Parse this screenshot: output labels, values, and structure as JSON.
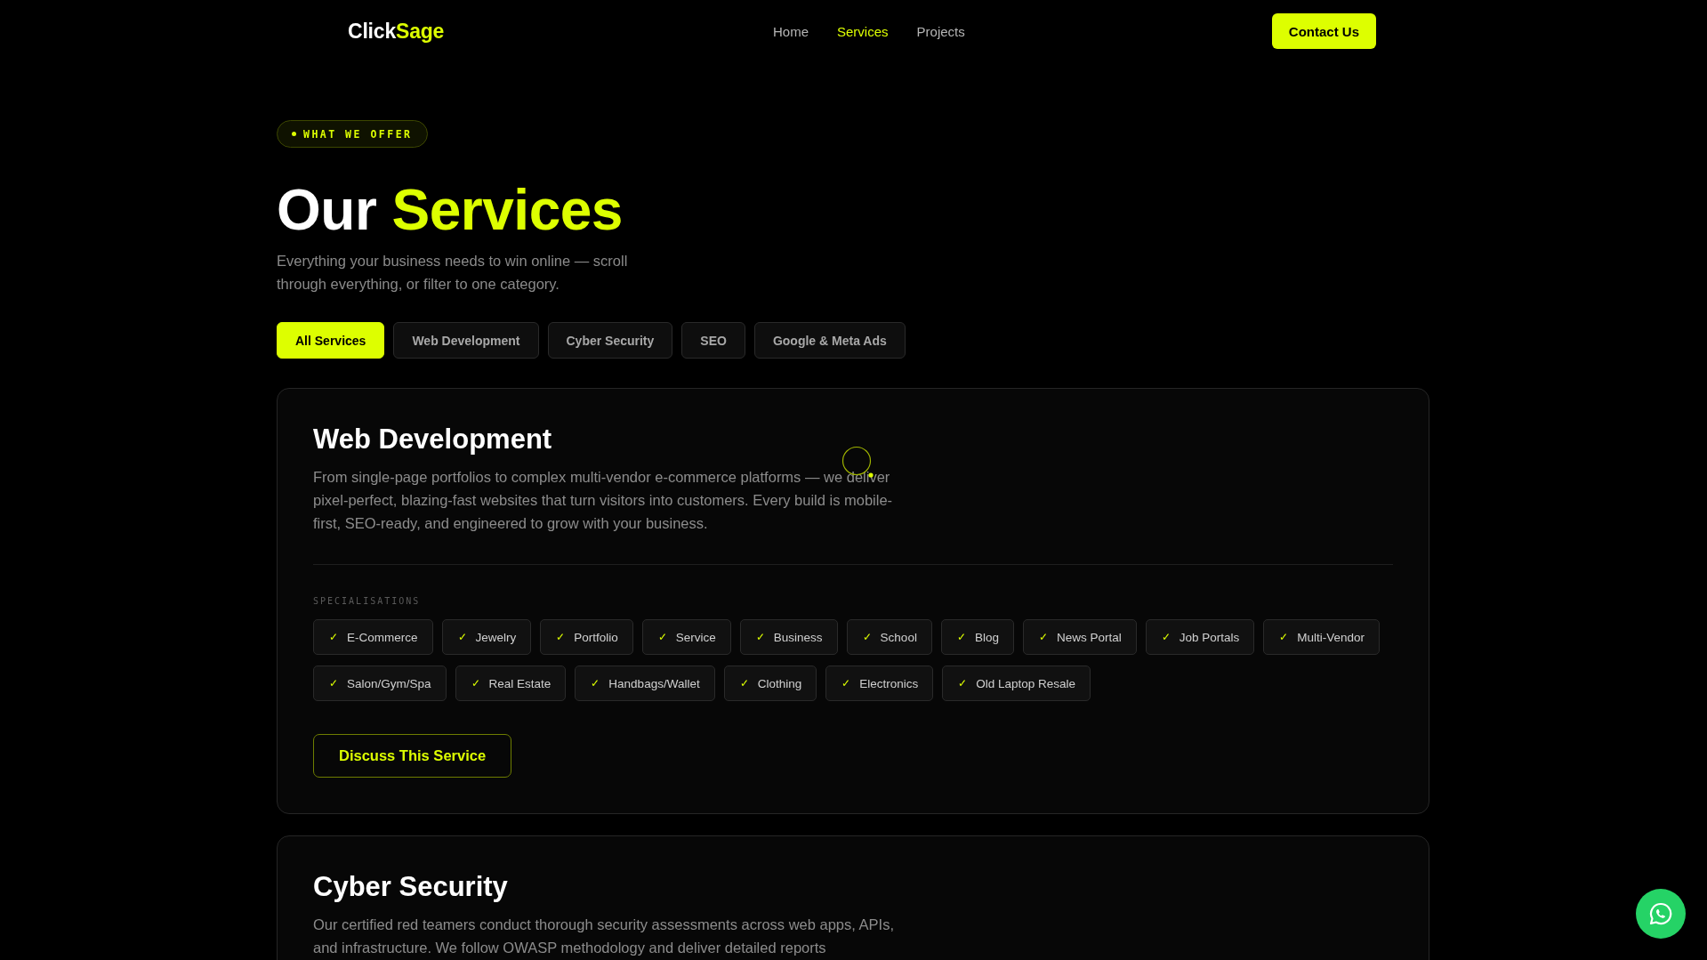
{
  "header": {
    "logo": {
      "part_1": "Click",
      "part_2": "Sage"
    },
    "nav": [
      {
        "label": "Home",
        "selected": false
      },
      {
        "label": "Services",
        "selected": true
      },
      {
        "label": "Projects",
        "selected": false
      }
    ],
    "cta": "Contact Us"
  },
  "hero": {
    "badge": "WHAT WE OFFER",
    "title_part_1": "Our",
    "title_part_2": "Services",
    "description": "Everything your business needs to win online — scroll through everything, or filter to one category."
  },
  "filters": [
    {
      "label": "All Services",
      "selected": true
    },
    {
      "label": "Web Development",
      "selected": false
    },
    {
      "label": "Cyber Security",
      "selected": false
    },
    {
      "label": "SEO",
      "selected": false
    },
    {
      "label": "Google & Meta Ads",
      "selected": false
    }
  ],
  "services": [
    {
      "title": "Web Development",
      "description": "From single-page portfolios to complex multi-vendor e-commerce platforms — we deliver pixel-perfect, blazing-fast websites that turn visitors into customers. Every build is mobile-first, SEO-ready, and engineered to grow with your business.",
      "specialisations_label": "SPECIALISATIONS",
      "check": "✓",
      "specialisations": [
        "E-Commerce",
        "Jewelry",
        "Portfolio",
        "Service",
        "Business",
        "School",
        "Blog",
        "News Portal",
        "Job Portals",
        "Multi-Vendor",
        "Salon/Gym/Spa",
        "Real Estate",
        "Handbags/Wallet",
        "Clothing",
        "Electronics",
        "Old Laptop Resale"
      ],
      "button": "Discuss This Service"
    },
    {
      "title": "Cyber Security",
      "description": "Our certified red teamers conduct thorough security assessments across web apps, APIs, and infrastructure. We follow OWASP methodology and deliver detailed reports"
    }
  ]
}
